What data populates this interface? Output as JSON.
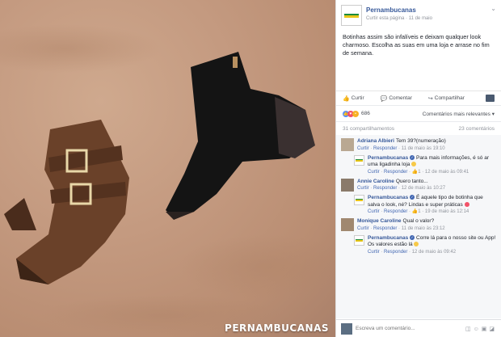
{
  "photo": {
    "watermark": "PERNAMBUCANAS"
  },
  "post": {
    "page_name": "Pernambucanas",
    "follow_label": "Curtir esta página",
    "date": "11 de maio",
    "text": "Botinhas assim são infalíveis e deixam qualquer look charmoso. Escolha as suas em uma loja e arrase no fim de semana.",
    "actions": {
      "like": "Curtir",
      "comment": "Comentar",
      "share": "Compartilhar"
    },
    "reactions_count": "686",
    "sort_label": "Comentários mais relevantes",
    "shares": "31 compartilhamentos",
    "comments_count": "23 comentários"
  },
  "comments": [
    {
      "name": "Adriana Albieri",
      "text": "Tem 39?(numeração)",
      "like": "Curtir",
      "reply": "Responder",
      "date": "11 de maio às 19:10"
    },
    {
      "name": "Pernambucanas",
      "text": "Para mais informações, é só ar uma ligadinha loja",
      "like": "Curtir",
      "reply": "Responder",
      "count": "1",
      "date": "12 de maio às 09:41"
    },
    {
      "name": "Annie Caroline",
      "text": "Quero tanto...",
      "like": "Curtir",
      "reply": "Responder",
      "date": "12 de maio às 10:27"
    },
    {
      "name": "Pernambucanas",
      "text": "É aquele tipo de botinha que salva o look, né? Lindas e super práticas",
      "like": "Curtir",
      "reply": "Responder",
      "count": "1",
      "date": "19 de maio às 12:14"
    },
    {
      "name": "Monique Caroline",
      "text": "Qual o valor?",
      "like": "Curtir",
      "reply": "Responder",
      "date": "11 de maio às 23:12"
    },
    {
      "name": "Pernambucanas",
      "text": "Corre lá para o nosso site ou App! Os valores estão lá",
      "like": "Curtir",
      "reply": "Responder",
      "date": "12 de maio às 09:42"
    }
  ],
  "composer": {
    "placeholder": "Escreva um comentário..."
  },
  "colors": {
    "link": "#365899",
    "like_reaction": "#5890ff",
    "love_reaction": "#f25268",
    "brand_green": "#1c8c3a",
    "brand_yellow": "#e8c51a"
  },
  "icons": [
    "thumbs-up-icon",
    "comment-icon",
    "share-icon",
    "chevron-down-icon",
    "camera-icon",
    "emoji-icon",
    "gif-icon",
    "sticker-icon"
  ]
}
